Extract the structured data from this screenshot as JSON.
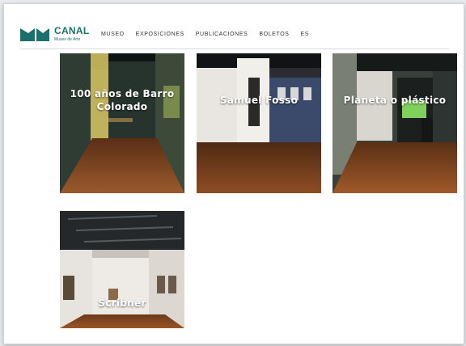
{
  "header": {
    "logo": {
      "name": "CANAL",
      "subtitle": "Museo de Arte"
    },
    "nav": [
      {
        "label": "MUSEO"
      },
      {
        "label": "EXPOSICIONES"
      },
      {
        "label": "PUBLICACIONES"
      },
      {
        "label": "BOLETOS"
      },
      {
        "label": "ES"
      }
    ]
  },
  "exhibitions": [
    {
      "title": "100 años de Barro Colorado"
    },
    {
      "title": "Samuel Fosso"
    },
    {
      "title": "Planeta o plástico"
    },
    {
      "title": "Scribner"
    }
  ],
  "colors": {
    "brand": "#1d6f6b",
    "gallery_floor": "#8a4a22",
    "gallery_wall": "#2f3e3a"
  }
}
